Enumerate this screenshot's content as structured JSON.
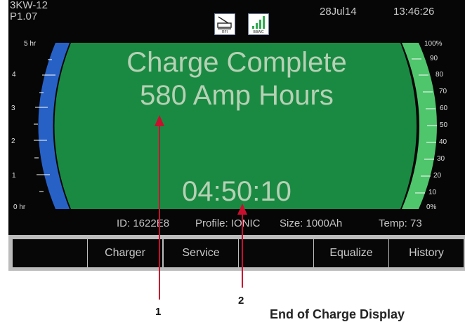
{
  "status": {
    "model": "3KW-12",
    "version": "P1.07",
    "date": "28Jul14",
    "time": "13:46:26",
    "icons": {
      "rfi": {
        "label": "RFI",
        "name": "rfi-icon"
      },
      "bbwc": {
        "label": "BBWC",
        "name": "bbwc-signal-icon"
      }
    }
  },
  "display": {
    "line1": "Charge Complete",
    "line2": "580 Amp Hours",
    "elapsed": "04:50:10",
    "colors": {
      "panel": "#1a8a43",
      "left_gauge": "#2761c6",
      "right_gauge": "#4fc56c"
    }
  },
  "left_gauge": {
    "labels": [
      "5 hr",
      "4",
      "3",
      "2",
      "1",
      "0 hr"
    ]
  },
  "right_gauge": {
    "labels": [
      "100%",
      "90",
      "80",
      "70",
      "60",
      "50",
      "40",
      "30",
      "20",
      "10",
      "0%"
    ]
  },
  "info": {
    "id": "ID: 1622E8",
    "profile": "Profile: IONIC",
    "size": "Size: 1000Ah",
    "temp": "Temp: 73"
  },
  "buttons": [
    "",
    "Charger",
    "Service",
    "",
    "Equalize",
    "History"
  ],
  "callouts": [
    "1",
    "2"
  ],
  "caption": "End of Charge Display"
}
